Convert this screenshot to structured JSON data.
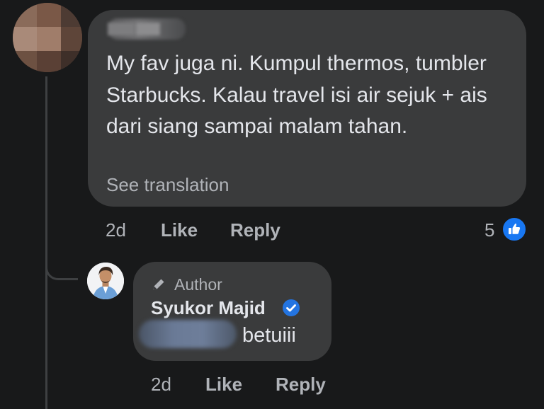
{
  "comment": {
    "text": "My fav juga ni. Kumpul thermos, tumbler Starbucks. Kalau travel isi air sejuk + ais dari siang sampai malam tahan.",
    "translate_link": "See translation",
    "time": "2d",
    "like_label": "Like",
    "reply_label": "Reply",
    "reaction_count": "5",
    "reaction_icon": "like-icon"
  },
  "reply": {
    "badge_label": "Author",
    "badge_icon": "pencil-icon",
    "author_name": "Syukor Majid",
    "verified_icon": "verified-badge-icon",
    "text": "betuiii",
    "time": "2d",
    "like_label": "Like",
    "reply_label": "Reply"
  },
  "colors": {
    "background": "#18191a",
    "bubble": "#3a3b3c",
    "primary_text": "#e4e6eb",
    "secondary_text": "#b0b3b8",
    "accent": "#1877f2"
  }
}
